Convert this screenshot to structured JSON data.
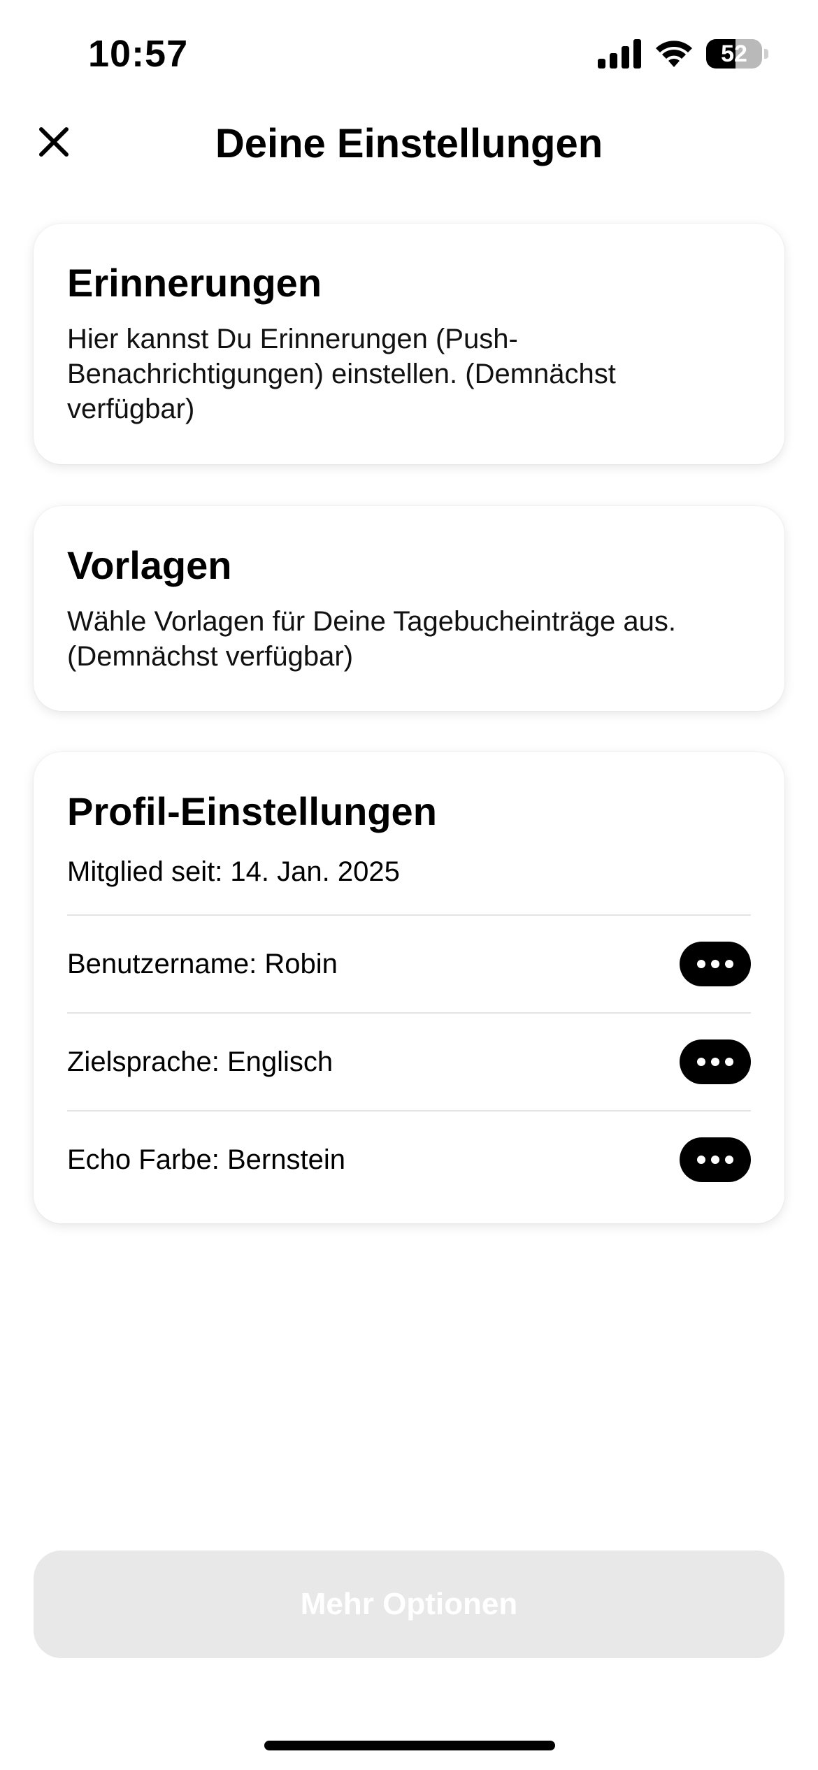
{
  "status_bar": {
    "time": "10:57",
    "battery_level": "52",
    "icons": [
      "cellular-signal-icon",
      "wifi-icon",
      "battery-icon"
    ]
  },
  "header": {
    "title": "Deine Einstellungen",
    "close_icon": "close-icon"
  },
  "cards": {
    "reminders": {
      "title": "Erinnerungen",
      "description": "Hier kannst Du Erinnerungen (Push-Benachrichtigungen) einstellen. (Demnächst verfügbar)"
    },
    "templates": {
      "title": "Vorlagen",
      "description": "Wähle Vorlagen für Deine Tagebucheinträge aus. (Demnächst verfügbar)"
    },
    "profile": {
      "title": "Profil-Einstellungen",
      "member_since": "Mitglied seit: 14. Jan. 2025",
      "rows": [
        {
          "label": "Benutzername: Robin",
          "icon": "more-horizontal-icon"
        },
        {
          "label": "Zielsprache: Englisch",
          "icon": "more-horizontal-icon"
        },
        {
          "label": "Echo Farbe: Bernstein",
          "icon": "more-horizontal-icon"
        }
      ]
    }
  },
  "footer": {
    "more_options_label": "Mehr Optionen"
  },
  "colors": {
    "background": "#ffffff",
    "text": "#000000",
    "button_disabled_bg": "#e8e8e8",
    "pill_button": "#000000",
    "divider": "#e3e3e3"
  }
}
